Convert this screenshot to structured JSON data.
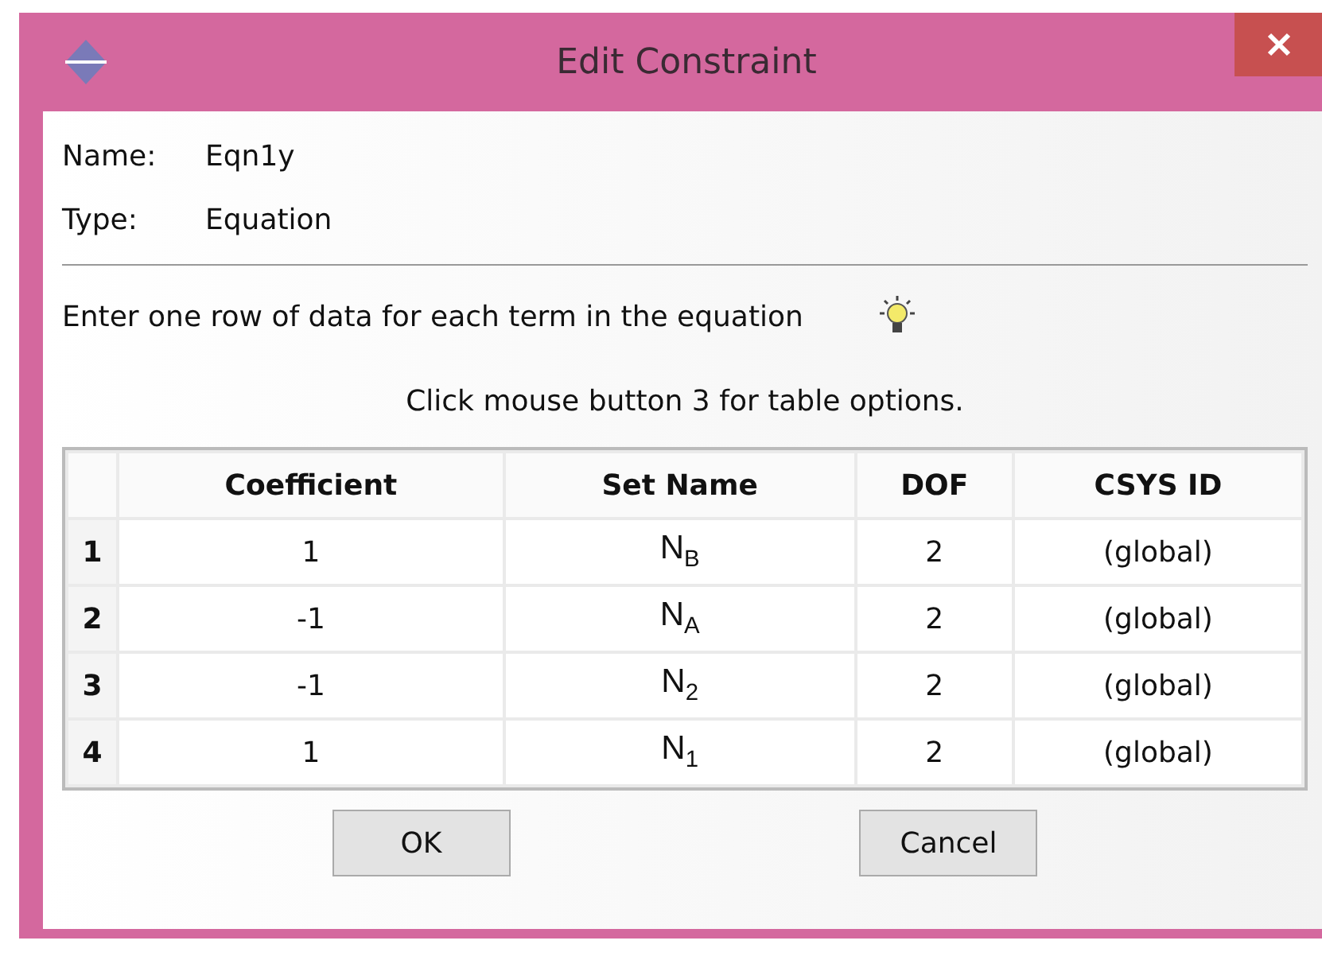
{
  "window": {
    "title": "Edit Constraint"
  },
  "fields": [
    {
      "label": "Name:",
      "value": "Eqn1y"
    },
    {
      "label": "Type:",
      "value": "Equation"
    }
  ],
  "instruction": "Enter one row of data for each term in the equation",
  "hint": "Click mouse button 3 for table options.",
  "table": {
    "columns": [
      "Coefficient",
      "Set Name",
      "DOF",
      "CSYS ID"
    ],
    "rows": [
      {
        "number": "1",
        "cells": [
          "1",
          "N$_{B}$",
          "2",
          "(global)"
        ]
      },
      {
        "number": "2",
        "cells": [
          "-1",
          "N$_{A}$",
          "2",
          "(global)"
        ]
      },
      {
        "number": "3",
        "cells": [
          "-1",
          "N$_{2}$",
          "2",
          "(global)"
        ]
      },
      {
        "number": "4",
        "cells": [
          "1",
          "N$_{1}$",
          "2",
          "(global)"
        ]
      }
    ]
  },
  "buttons": [
    "OK",
    "Cancel"
  ]
}
